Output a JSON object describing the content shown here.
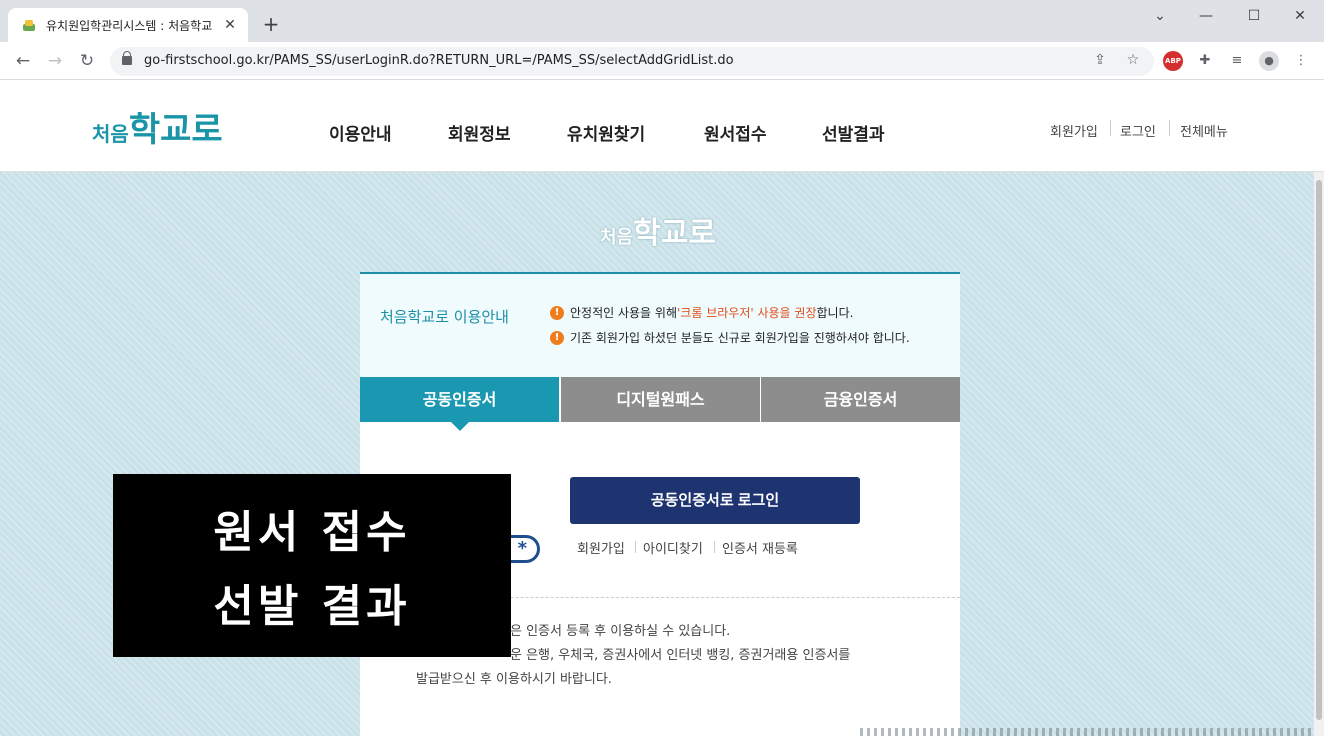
{
  "browser": {
    "tab_title": "유치원입학관리시스템 : 처음학교",
    "tab_close": "✕",
    "new_tab": "+",
    "url": "go-firstschool.go.kr/PAMS_SS/userLoginR.do?RETURN_URL=/PAMS_SS/selectAddGridList.do",
    "win_minimize": "⌄",
    "win_restore": "—",
    "win_maximize": "☐",
    "win_close": "✕",
    "back": "←",
    "forward": "→",
    "reload": "↻",
    "share_icon": "⇪",
    "star_icon": "☆",
    "ext_abp": "ABP",
    "ext_puzzle": "✚",
    "ext_media": "≡",
    "ext_profile": "●",
    "ext_menu": "⋮"
  },
  "site": {
    "logo_small": "처음",
    "logo_big": "학교로",
    "nav": [
      "이용안내",
      "회원정보",
      "유치원찾기",
      "원서접수",
      "선발결과"
    ],
    "util": [
      "회원가입",
      "로그인",
      "전체메뉴"
    ]
  },
  "notice": {
    "title": "처음학교로 이용안내",
    "warn_glyph": "!",
    "line1_a": "안정적인 사용을 위해 ",
    "line1_b": "'크롬 브라우저' 사용을 권장",
    "line1_c": "합니다.",
    "line2": "기존 회원가입 하셨던 분들도 신규로 회원가입을 진행하셔야 합니다."
  },
  "tabs": [
    "공동인증서",
    "디지털원패스",
    "금융인증서"
  ],
  "login": {
    "button": "공동인증서로 로그인",
    "links": [
      "회원가입",
      "아이디찾기",
      "인증서 재등록"
    ],
    "pw_glyph": "*"
  },
  "info": {
    "line1": "은 인증서 등록 후 이용하실 수 있습니다.",
    "line2": "운 은행, 우체국, 증권사에서 인터넷 뱅킹, 증권거래용 인증서를",
    "line3": "발급받으신 후 이용하시기 바랍니다."
  },
  "overlay": {
    "line1": "원서 접수",
    "line2": "선발 결과"
  },
  "colors": {
    "accent": "#1b98b1",
    "login_button": "#1e3470",
    "tab_inactive": "#8d8d8d",
    "warning": "#f07d1c",
    "page_bg": "#c9e1e8"
  }
}
